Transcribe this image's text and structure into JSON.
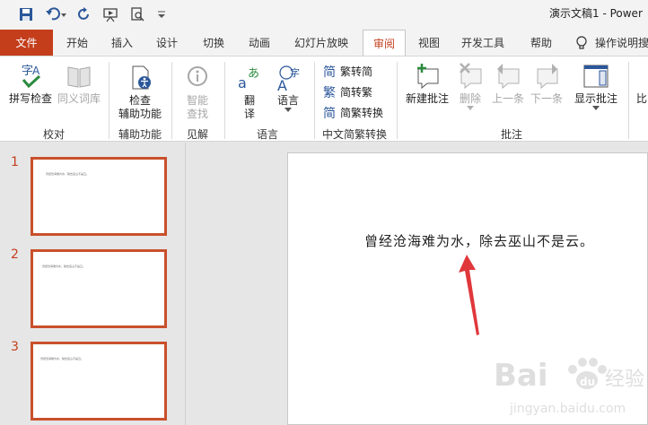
{
  "window": {
    "title": "演示文稿1  -  Power"
  },
  "quick_access": [
    {
      "name": "save-icon"
    },
    {
      "name": "undo-icon"
    },
    {
      "name": "redo-icon"
    },
    {
      "name": "presentation-icon"
    },
    {
      "name": "print-preview-icon"
    },
    {
      "name": "customize-dropdown-icon"
    }
  ],
  "tabs": [
    {
      "id": "file",
      "label": "文件"
    },
    {
      "id": "home",
      "label": "开始"
    },
    {
      "id": "insert",
      "label": "插入"
    },
    {
      "id": "design",
      "label": "设计"
    },
    {
      "id": "transitions",
      "label": "切换"
    },
    {
      "id": "animations",
      "label": "动画"
    },
    {
      "id": "slideshow",
      "label": "幻灯片放映"
    },
    {
      "id": "review",
      "label": "审阅",
      "active": true
    },
    {
      "id": "view",
      "label": "视图"
    },
    {
      "id": "developer",
      "label": "开发工具"
    },
    {
      "id": "help",
      "label": "帮助"
    }
  ],
  "tell_me": {
    "label": "操作说明搜"
  },
  "ribbon": {
    "proofing": {
      "label": "校对",
      "spelling": "拼写检查",
      "thesaurus": "同义词库"
    },
    "accessibility": {
      "label": "辅助功能",
      "check_line1": "检查",
      "check_line2": "辅助功能"
    },
    "insights": {
      "label": "见解",
      "smart_line1": "智能",
      "smart_line2": "查找"
    },
    "language": {
      "label": "语言",
      "translate_line1": "翻",
      "translate_line2": "译",
      "language_btn": "语言"
    },
    "chinese": {
      "label": "中文简繁转换",
      "t2s": "繁转简",
      "s2t": "简转繁",
      "convert": "简繁转换"
    },
    "comments": {
      "label": "批注",
      "new": "新建批注",
      "delete": "删除",
      "prev": "上一条",
      "next": "下一条",
      "show": "显示批注"
    },
    "compare": {
      "label": "比"
    }
  },
  "slides": [
    {
      "number": "1",
      "text": "曾经沧海难为水，除去巫山不是云。"
    },
    {
      "number": "2",
      "text": "曾经沧海难为水，除去巫山不是云。"
    },
    {
      "number": "3",
      "text": "曾经沧海难为水，除去巫山不是云。"
    }
  ],
  "current_slide": {
    "text": "曾经沧海难为水，除去巫山不是云。"
  },
  "annotation": {
    "type": "red-arrow",
    "color": "#e0373b"
  },
  "watermark": {
    "text_main": "Bai",
    "text_du": "du",
    "text_cn": "经验",
    "text_url": "jingyan.baidu.com"
  },
  "colors": {
    "accent": "#c43e1c",
    "thumb_border": "#c9502b",
    "arrow": "#e0373b"
  }
}
